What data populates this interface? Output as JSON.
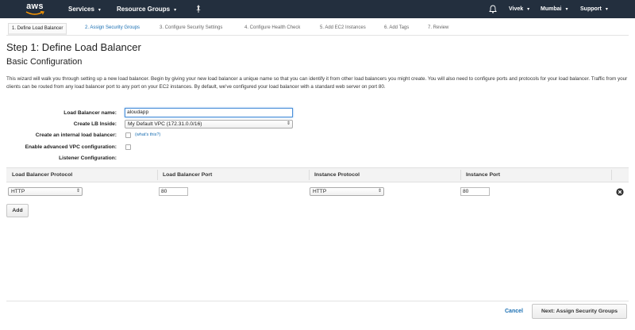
{
  "nav": {
    "logo": "aws",
    "services": "Services",
    "resource_groups": "Resource Groups",
    "user": "Vivek",
    "region": "Mumbai",
    "support": "Support",
    "icons": [
      "pin-icon",
      "bell-icon"
    ]
  },
  "steps": [
    {
      "label": "1. Define Load Balancer"
    },
    {
      "label": "2. Assign Security Groups"
    },
    {
      "label": "3. Configure Security Settings"
    },
    {
      "label": "4. Configure Health Check"
    },
    {
      "label": "5. Add EC2 Instances"
    },
    {
      "label": "6. Add Tags"
    },
    {
      "label": "7. Review"
    }
  ],
  "page": {
    "title": "Step 1: Define Load Balancer",
    "subtitle": "Basic Configuration",
    "intro": "This wizard will walk you through setting up a new load balancer. Begin by giving your new load balancer a unique name so that you can identify it from other load balancers you might create. You will also need to configure ports and protocols for your load balancer. Traffic from your clients can be routed from any load balancer port to any port on your EC2 instances. By default, we've configured your load balancer with a standard web server on port 80."
  },
  "form": {
    "name_label": "Load Balancer name:",
    "name_value": "aloudapp",
    "create_inside_label": "Create LB Inside:",
    "create_inside_value": "My Default VPC (172.31.0.0/16)",
    "internal_label": "Create an internal load balancer:",
    "whats_this": "(what's this?)",
    "advanced_vpc_label": "Enable advanced VPC configuration:",
    "listener_label": "Listener Configuration:"
  },
  "listener_table": {
    "headers": [
      "Load Balancer Protocol",
      "Load Balancer Port",
      "Instance Protocol",
      "Instance Port"
    ],
    "rows": [
      {
        "lb_protocol": "HTTP",
        "lb_port": "80",
        "instance_protocol": "HTTP",
        "instance_port": "80"
      }
    ],
    "add_label": "Add"
  },
  "footer": {
    "cancel": "Cancel",
    "next": "Next: Assign Security Groups"
  }
}
